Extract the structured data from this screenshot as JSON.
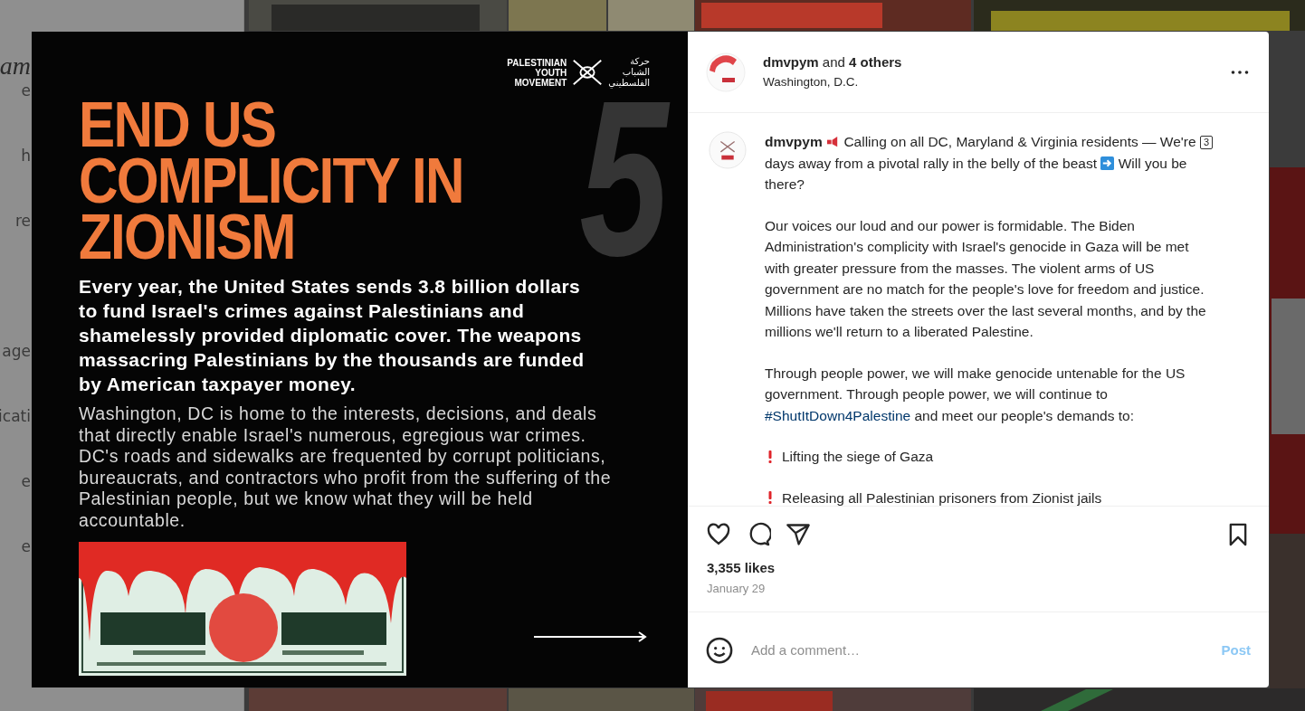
{
  "sidebar": {
    "logo": "am",
    "items": [
      {
        "label": "e"
      },
      {
        "label": "h"
      },
      {
        "label": "re"
      },
      {
        "label": "age"
      },
      {
        "label": "icati"
      },
      {
        "label": "e"
      },
      {
        "label": "e"
      }
    ]
  },
  "post_image": {
    "logo": {
      "name_lines": [
        "PALESTINIAN",
        "YOUTH",
        "MOVEMENT"
      ],
      "arabic_lines": [
        "حركة",
        "الشباب",
        "الفلسطيني"
      ]
    },
    "number": "5",
    "headline": [
      "END US",
      "COMPLICITY IN",
      "ZIONISM"
    ],
    "lead": "Every year, the United States sends 3.8 billion dollars to fund Israel's crimes against Palestinians and shamelessly provided diplomatic cover. The weapons massacring Palestinians by the thousands are funded by American taxpayer money.",
    "body": "Washington, DC is home to the interests, decisions, and deals that directly enable Israel's numerous, egregious war crimes. DC's roads and sidewalks are frequented by corrupt politicians, bureaucrats, and contractors who profit from the suffering of the Palestinian people, but we know what they will be held accountable."
  },
  "post_panel": {
    "header": {
      "accounts": "**dmvpym** and **4 others**",
      "location": "Washington, D.C."
    },
    "caption": {
      "intro": [
        {
          "kind": "username",
          "text": "dmvpym"
        },
        {
          "kind": "megaphone"
        },
        {
          "kind": "text",
          "text": "Calling on all DC, Maryland & Virginia residents — We're"
        },
        {
          "kind": "keycap",
          "text": "3"
        },
        {
          "kind": "text",
          "text": "days away from a pivotal rally in the belly of the beast"
        },
        {
          "kind": "arrow"
        },
        {
          "kind": "text",
          "text": "Will you be there?"
        }
      ],
      "paragraphs": [
        [
          {
            "kind": "text",
            "text": "Our voices our loud and our power is formidable. The Biden Administration's complicity with Israel's genocide in Gaza will be met with greater pressure from the masses. The violent arms of US government are no match for the people's love for freedom and justice. Millions have taken the streets over the last several months, and by the millions we'll return to a liberated Palestine."
          }
        ],
        [
          {
            "kind": "text",
            "text": "Through people power, we will make genocide untenable for the US government. Through people power, we will continue to"
          },
          {
            "kind": "hashtag",
            "text": "#ShutItDown4Palestine"
          },
          {
            "kind": "text",
            "text": "and meet our people's demands to:"
          }
        ]
      ],
      "demands": [
        "Lifting the siege of Gaza",
        "Releasing all Palestinian prisoners from Zionist jails"
      ]
    },
    "likes": "3,355 likes",
    "date": "January 29",
    "comment": {
      "placeholder": "Add a comment…",
      "post_button": {
        "label": "Post",
        "disabled": true
      }
    }
  }
}
